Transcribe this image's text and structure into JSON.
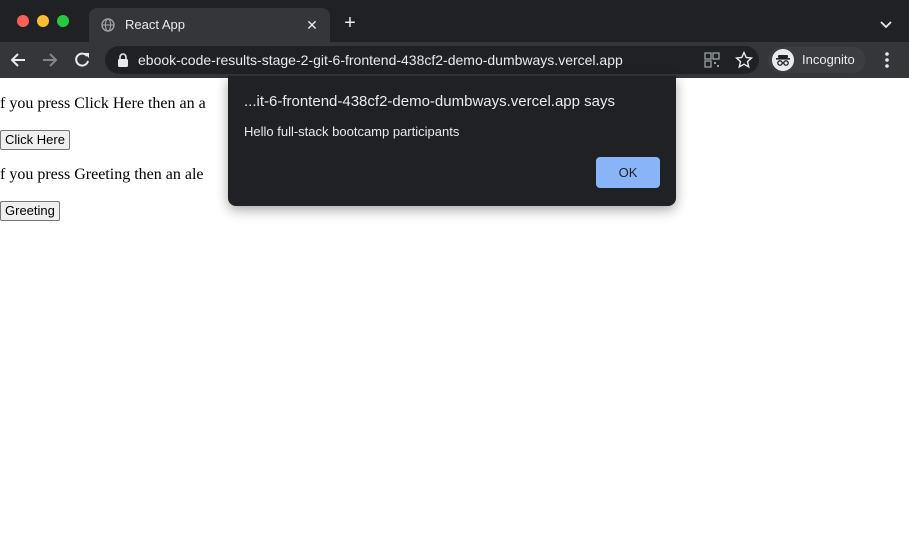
{
  "window": {
    "traffic_lights": {
      "close": "#ff5f57",
      "minimize": "#febc2e",
      "zoom": "#28c840"
    }
  },
  "tab": {
    "title": "React App",
    "favicon": "globe-icon",
    "close_glyph": "✕",
    "new_tab_glyph": "+"
  },
  "toolbar": {
    "url": "ebook-code-results-stage-2-git-6-frontend-438cf2-demo-dumbways.vercel.app",
    "incognito_label": "Incognito"
  },
  "page": {
    "paragraph_1": "f you press Click Here then an a",
    "button_1": "Click Here",
    "paragraph_2": "f you press Greeting then an ale",
    "button_2": "Greeting"
  },
  "dialog": {
    "title": "...it-6-frontend-438cf2-demo-dumbways.vercel.app says",
    "message": "Hello full-stack bootcamp participants",
    "ok_label": "OK",
    "ok_color": "#8ab4f8"
  }
}
